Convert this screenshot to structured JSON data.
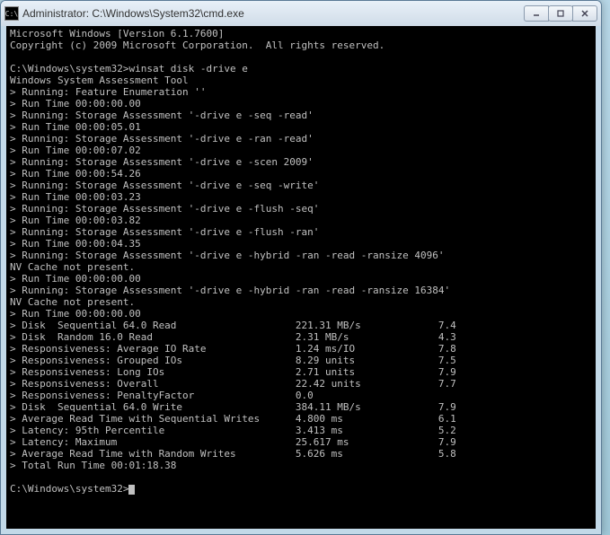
{
  "window": {
    "title": "Administrator: C:\\Windows\\System32\\cmd.exe",
    "icon_label": "C:\\"
  },
  "console": {
    "banner_line1": "Microsoft Windows [Version 6.1.7600]",
    "banner_line2": "Copyright (c) 2009 Microsoft Corporation.  All rights reserved.",
    "prompt_path": "C:\\Windows\\system32>",
    "command": "winsat disk -drive e",
    "tool_name": "Windows System Assessment Tool",
    "lines": [
      "> Running: Feature Enumeration ''",
      "> Run Time 00:00:00.00",
      "> Running: Storage Assessment '-drive e -seq -read'",
      "> Run Time 00:00:05.01",
      "> Running: Storage Assessment '-drive e -ran -read'",
      "> Run Time 00:00:07.02",
      "> Running: Storage Assessment '-drive e -scen 2009'",
      "> Run Time 00:00:54.26",
      "> Running: Storage Assessment '-drive e -seq -write'",
      "> Run Time 00:00:03.23",
      "> Running: Storage Assessment '-drive e -flush -seq'",
      "> Run Time 00:00:03.82",
      "> Running: Storage Assessment '-drive e -flush -ran'",
      "> Run Time 00:00:04.35",
      "> Running: Storage Assessment '-drive e -hybrid -ran -read -ransize 4096'",
      "NV Cache not present.",
      "> Run Time 00:00:00.00",
      "> Running: Storage Assessment '-drive e -hybrid -ran -read -ransize 16384'",
      "NV Cache not present.",
      "> Run Time 00:00:00.00"
    ],
    "results": [
      {
        "label": "> Disk  Sequential 64.0 Read",
        "value": "221.31 MB/s",
        "score": "7.4"
      },
      {
        "label": "> Disk  Random 16.0 Read",
        "value": "2.31 MB/s",
        "score": "4.3"
      },
      {
        "label": "> Responsiveness: Average IO Rate",
        "value": "1.24 ms/IO",
        "score": "7.8"
      },
      {
        "label": "> Responsiveness: Grouped IOs",
        "value": "8.29 units",
        "score": "7.5"
      },
      {
        "label": "> Responsiveness: Long IOs",
        "value": "2.71 units",
        "score": "7.9"
      },
      {
        "label": "> Responsiveness: Overall",
        "value": "22.42 units",
        "score": "7.7"
      },
      {
        "label": "> Responsiveness: PenaltyFactor",
        "value": "0.0",
        "score": ""
      },
      {
        "label": "> Disk  Sequential 64.0 Write",
        "value": "384.11 MB/s",
        "score": "7.9"
      },
      {
        "label": "> Average Read Time with Sequential Writes",
        "value": "4.800 ms",
        "score": "6.1"
      },
      {
        "label": "> Latency: 95th Percentile",
        "value": "3.413 ms",
        "score": "5.2"
      },
      {
        "label": "> Latency: Maximum",
        "value": "25.617 ms",
        "score": "7.9"
      },
      {
        "label": "> Average Read Time with Random Writes",
        "value": "5.626 ms",
        "score": "5.8"
      }
    ],
    "total_line": "> Total Run Time 00:01:18.38",
    "final_prompt": "C:\\Windows\\system32>"
  }
}
